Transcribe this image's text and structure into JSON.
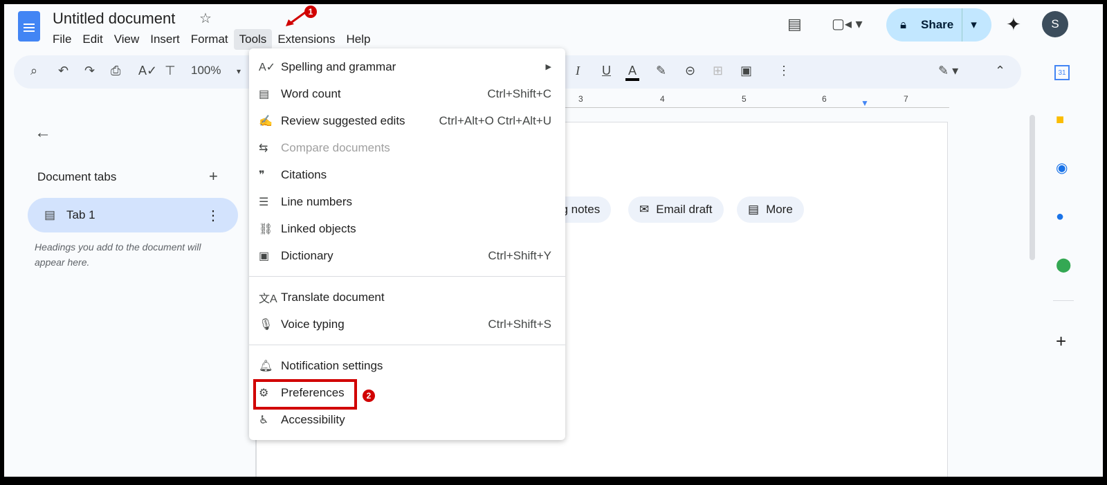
{
  "header": {
    "title": "Untitled document",
    "menu": [
      "File",
      "Edit",
      "View",
      "Insert",
      "Format",
      "Tools",
      "Extensions",
      "Help"
    ],
    "share_label": "Share",
    "avatar_initial": "S"
  },
  "toolbar": {
    "zoom": "100%"
  },
  "ruler": [
    "3",
    "4",
    "5",
    "6",
    "7"
  ],
  "sidebar": {
    "heading": "Document tabs",
    "tab": "Tab 1",
    "hint": "Headings you add to the document will appear here."
  },
  "chips": [
    "ng notes",
    "Email draft",
    "More"
  ],
  "tools_menu": {
    "groups": [
      [
        {
          "icon": "spellcheck-icon",
          "label": "Spelling and grammar",
          "shortcut": "",
          "submenu": true
        },
        {
          "icon": "word-count-icon",
          "label": "Word count",
          "shortcut": "Ctrl+Shift+C"
        },
        {
          "icon": "review-edits-icon",
          "label": "Review suggested edits",
          "shortcut": "Ctrl+Alt+O Ctrl+Alt+U"
        },
        {
          "icon": "compare-icon",
          "label": "Compare documents",
          "shortcut": "",
          "disabled": true
        },
        {
          "icon": "quote-icon",
          "label": "Citations",
          "shortcut": ""
        },
        {
          "icon": "line-numbers-icon",
          "label": "Line numbers",
          "shortcut": ""
        },
        {
          "icon": "linked-objects-icon",
          "label": "Linked objects",
          "shortcut": ""
        },
        {
          "icon": "dictionary-icon",
          "label": "Dictionary",
          "shortcut": "Ctrl+Shift+Y"
        }
      ],
      [
        {
          "icon": "translate-icon",
          "label": "Translate document",
          "shortcut": ""
        },
        {
          "icon": "mic-icon",
          "label": "Voice typing",
          "shortcut": "Ctrl+Shift+S"
        }
      ],
      [
        {
          "icon": "bell-icon",
          "label": "Notification settings",
          "shortcut": ""
        },
        {
          "icon": "preferences-icon",
          "label": "Preferences",
          "shortcut": "",
          "highlighted": true
        },
        {
          "icon": "accessibility-icon",
          "label": "Accessibility",
          "shortcut": ""
        }
      ]
    ]
  },
  "annotations": {
    "step1": "1",
    "step2": "2",
    "color": "#d10000"
  }
}
